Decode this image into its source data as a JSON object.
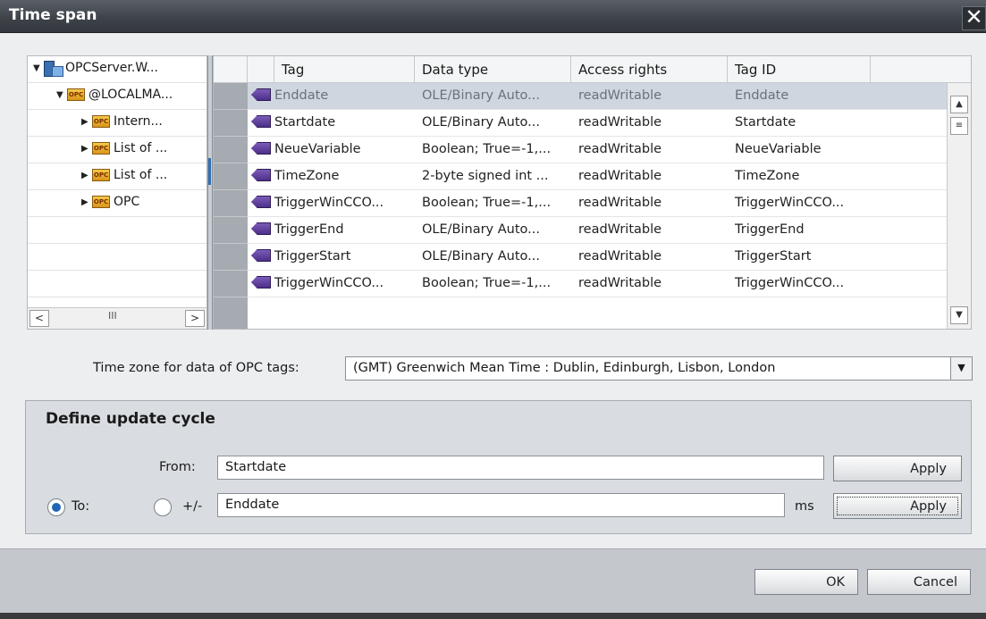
{
  "window": {
    "title": "Time span",
    "close_glyph": "✕"
  },
  "tree": {
    "items": [
      {
        "label": "OPCServer.W...",
        "icon": "server-icon",
        "expanded": true
      },
      {
        "label": "@LOCALMA...",
        "icon": "opc-folder-icon",
        "expanded": true
      },
      {
        "label": "Intern...",
        "icon": "opc-folder-icon",
        "expanded": false
      },
      {
        "label": "List of ...",
        "icon": "opc-folder-icon",
        "expanded": false
      },
      {
        "label": "List of ...",
        "icon": "opc-folder-icon",
        "expanded": false
      },
      {
        "label": "OPC",
        "icon": "opc-folder-icon",
        "expanded": false
      }
    ],
    "opc_badge": "OPC",
    "scroll_left": "<",
    "scroll_grip": "III",
    "scroll_right": ">"
  },
  "table": {
    "columns": [
      "Tag",
      "Data type",
      "Access rights",
      "Tag ID"
    ],
    "rows": [
      {
        "tag": "Enddate",
        "data_type": "OLE/Binary Auto...",
        "access": "readWritable",
        "tag_id": "Enddate",
        "selected": true
      },
      {
        "tag": "Startdate",
        "data_type": "OLE/Binary Auto...",
        "access": "readWritable",
        "tag_id": "Startdate"
      },
      {
        "tag": "NeueVariable",
        "data_type": "Boolean; True=-1,...",
        "access": "readWritable",
        "tag_id": "NeueVariable"
      },
      {
        "tag": "TimeZone",
        "data_type": "2-byte signed int ...",
        "access": "readWritable",
        "tag_id": "TimeZone"
      },
      {
        "tag": "TriggerWinCCO...",
        "data_type": "Boolean; True=-1,...",
        "access": "readWritable",
        "tag_id": "TriggerWinCCO..."
      },
      {
        "tag": "TriggerEnd",
        "data_type": "OLE/Binary Auto...",
        "access": "readWritable",
        "tag_id": "TriggerEnd"
      },
      {
        "tag": "TriggerStart",
        "data_type": "OLE/Binary Auto...",
        "access": "readWritable",
        "tag_id": "TriggerStart"
      },
      {
        "tag": "TriggerWinCCO...",
        "data_type": "Boolean; True=-1,...",
        "access": "readWritable",
        "tag_id": "TriggerWinCCO..."
      }
    ],
    "scroll_up": "▲",
    "scroll_mid": "≡",
    "scroll_down": "▼"
  },
  "timezone": {
    "label": "Time zone for data of OPC tags:",
    "value": "(GMT) Greenwich Mean Time : Dublin, Edinburgh, Lisbon, London",
    "arrow": "▼"
  },
  "update_cycle": {
    "title": "Define update cycle",
    "from_label": "From:",
    "from_value": "Startdate",
    "apply_label": "Apply",
    "to_label": "To:",
    "plusminus_label": "+/-",
    "to_value": "Enddate",
    "unit": "ms",
    "to_radio_selected": true
  },
  "footer": {
    "ok_label": "OK",
    "cancel_label": "Cancel"
  },
  "colors": {
    "selection": "#cfd6df",
    "accent": "#1f66b3",
    "titlebar": "#3f434a"
  }
}
